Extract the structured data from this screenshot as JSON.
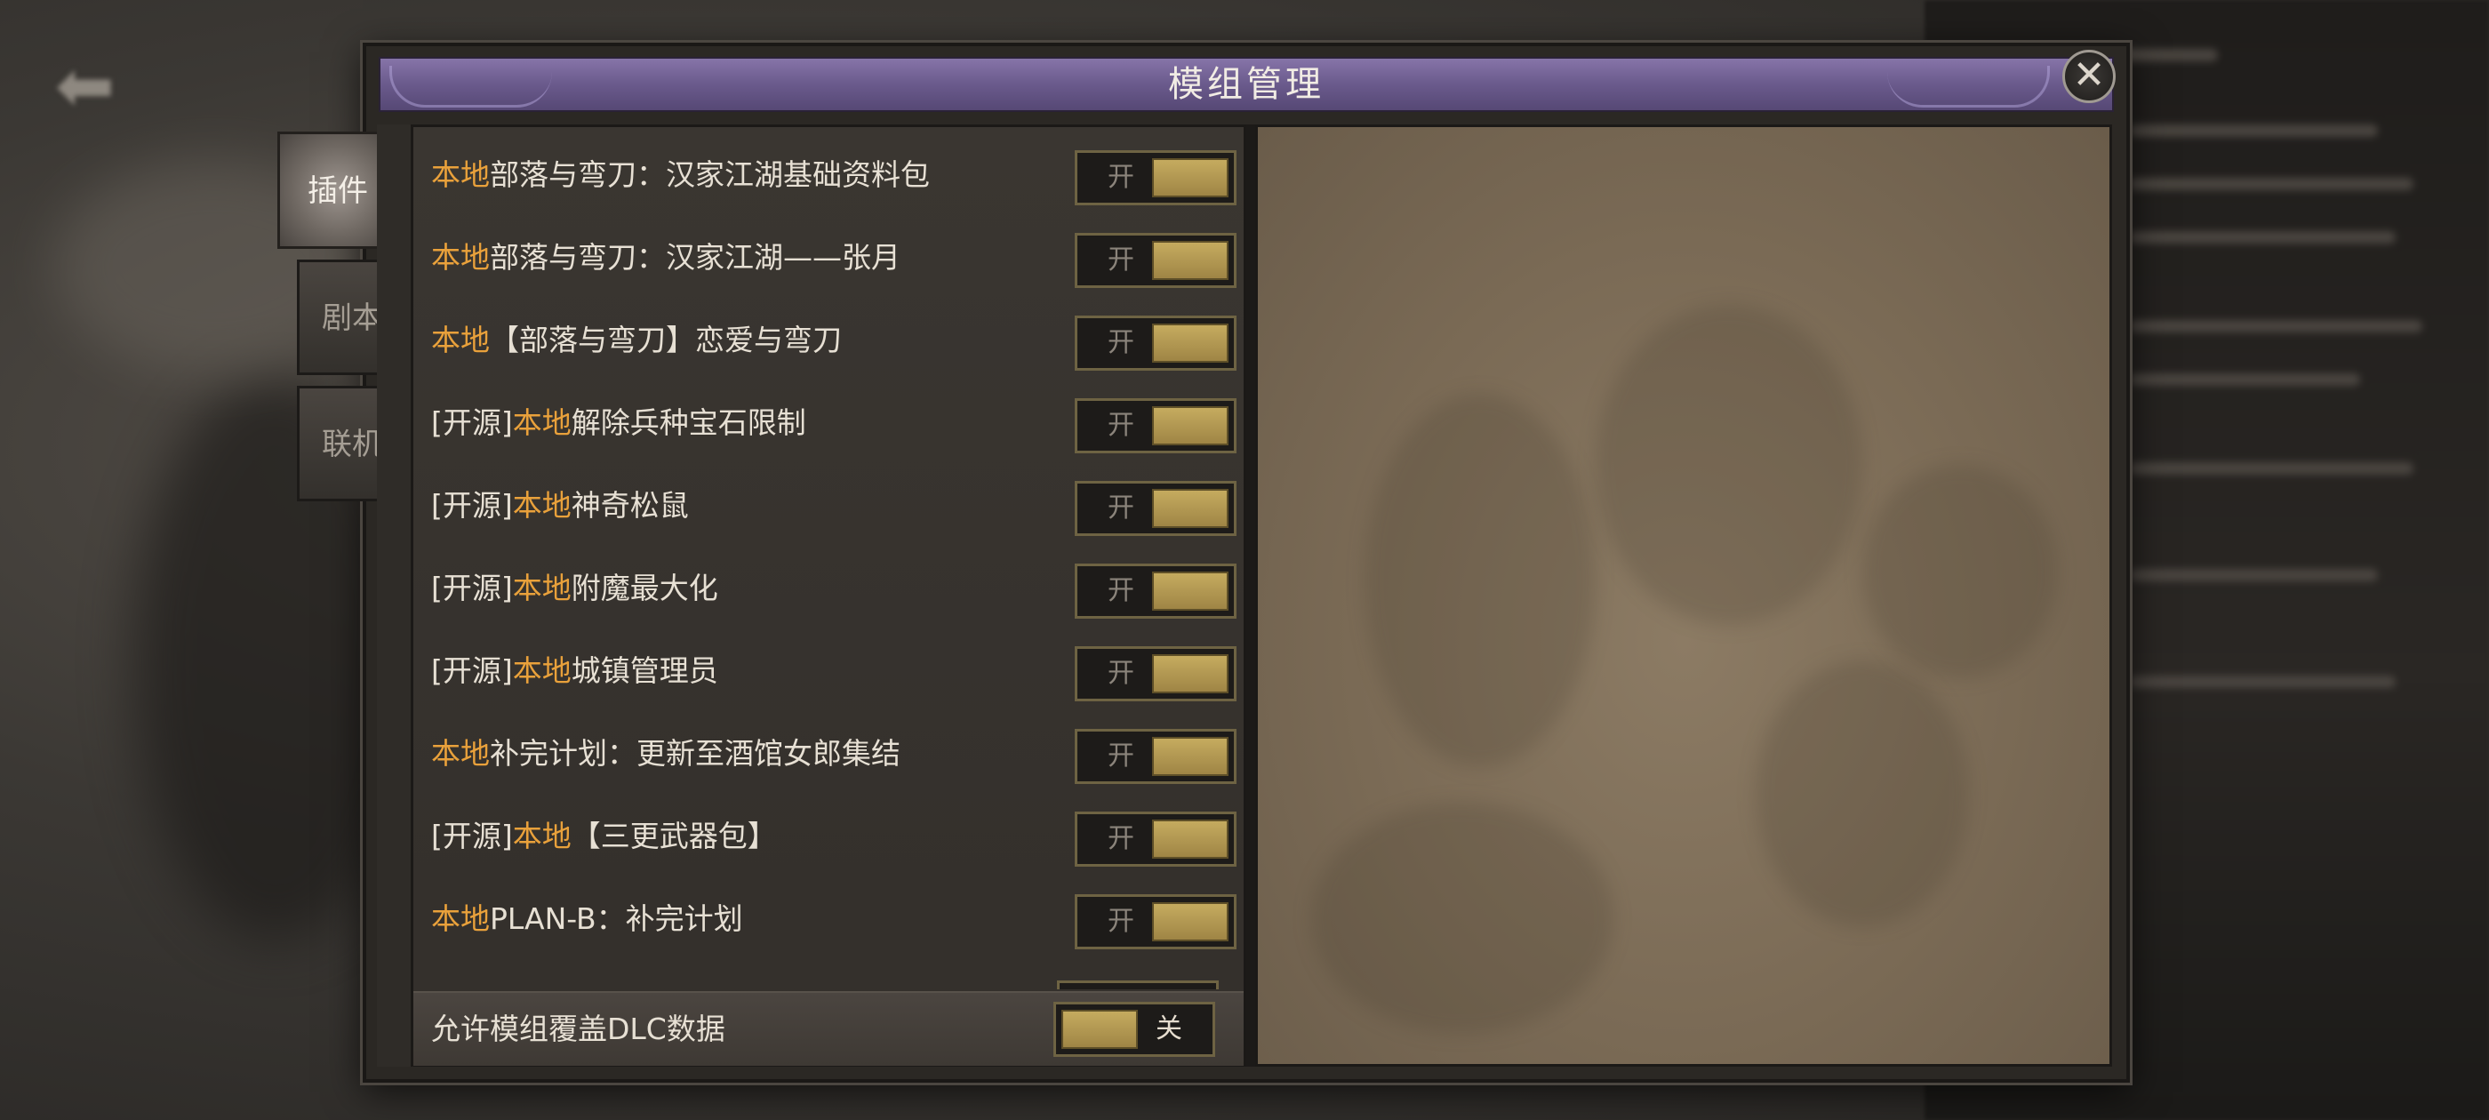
{
  "dialog": {
    "title": "模组管理"
  },
  "tabs": [
    {
      "label": "插件",
      "active": true
    },
    {
      "label": "剧本",
      "active": false
    },
    {
      "label": "联机",
      "active": false
    }
  ],
  "mods": [
    {
      "prefix": "",
      "local": "本地",
      "name": "部落与弯刀：汉家江湖基础资料包",
      "toggle": "开"
    },
    {
      "prefix": "",
      "local": "本地",
      "name": "部落与弯刀：汉家江湖——张月",
      "toggle": "开"
    },
    {
      "prefix": "",
      "local": "本地",
      "name": "【部落与弯刀】恋爱与弯刀",
      "toggle": "开"
    },
    {
      "prefix": "[开源]",
      "local": "本地",
      "name": "解除兵种宝石限制",
      "toggle": "开"
    },
    {
      "prefix": "[开源]",
      "local": "本地",
      "name": "神奇松鼠",
      "toggle": "开"
    },
    {
      "prefix": "[开源]",
      "local": "本地",
      "name": "附魔最大化",
      "toggle": "开"
    },
    {
      "prefix": "[开源]",
      "local": "本地",
      "name": "城镇管理员",
      "toggle": "开"
    },
    {
      "prefix": "",
      "local": "本地",
      "name": "补完计划：更新至酒馆女郎集结",
      "toggle": "开"
    },
    {
      "prefix": "[开源]",
      "local": "本地",
      "name": "【三更武器包】",
      "toggle": "开"
    },
    {
      "prefix": "",
      "local": "本地",
      "name": "PLAN-B：补完计划",
      "toggle": "开"
    }
  ],
  "bottom": {
    "label": "允许模组覆盖DLC数据",
    "toggle": "关"
  },
  "colors": {
    "local_tag": "#e9a13b",
    "title_bar": "#6a5a8c",
    "toggle_knob": "#c5ab5f"
  },
  "icons": {
    "close": "close-icon",
    "back": "back-arrow-icon"
  }
}
